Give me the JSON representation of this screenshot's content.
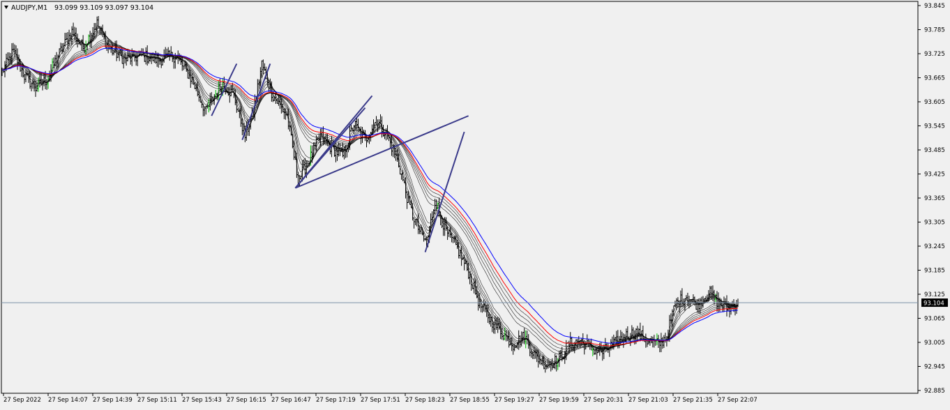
{
  "header": {
    "symbol_label": "AUDJPY,M1",
    "ohlc": "93.099 93.109 93.097 93.104"
  },
  "colors": {
    "background": "#f0f0f0",
    "bars": "#000000",
    "up_tick": "#00c000",
    "ema_fast": "#000000",
    "ema_mid": "#ff0000",
    "ema_slow": "#0000ff",
    "trendline": "#3a3a8a",
    "price_line": "#7a8fa8",
    "price_label_bg": "#000000",
    "price_label_text": "#ffffff"
  },
  "chart_data": {
    "type": "candlestick-bars",
    "symbol": "AUDJPY",
    "timeframe": "M1",
    "current_price": "93.104",
    "ylim": [
      92.885,
      93.845
    ],
    "y_ticks": [
      "93.845",
      "93.785",
      "93.725",
      "93.665",
      "93.605",
      "93.545",
      "93.485",
      "93.425",
      "93.365",
      "93.305",
      "93.245",
      "93.185",
      "93.125",
      "93.065",
      "93.005",
      "92.945",
      "92.885"
    ],
    "x_ticks": [
      "27 Sep 2022",
      "27 Sep 14:07",
      "27 Sep 14:39",
      "27 Sep 15:11",
      "27 Sep 15:43",
      "27 Sep 16:15",
      "27 Sep 16:47",
      "27 Sep 17:19",
      "27 Sep 17:51",
      "27 Sep 18:23",
      "27 Sep 18:55",
      "27 Sep 19:27",
      "27 Sep 19:59",
      "27 Sep 20:31",
      "27 Sep 21:03",
      "27 Sep 21:35",
      "27 Sep 22:07"
    ],
    "x_minutes": [
      0,
      527
    ],
    "price_path": [
      [
        0,
        93.68
      ],
      [
        8,
        93.73
      ],
      [
        16,
        93.67
      ],
      [
        24,
        93.64
      ],
      [
        32,
        93.66
      ],
      [
        40,
        93.72
      ],
      [
        50,
        93.78
      ],
      [
        58,
        93.74
      ],
      [
        68,
        93.8
      ],
      [
        76,
        93.74
      ],
      [
        88,
        93.71
      ],
      [
        100,
        93.72
      ],
      [
        112,
        93.71
      ],
      [
        124,
        93.72
      ],
      [
        136,
        93.66
      ],
      [
        146,
        93.58
      ],
      [
        152,
        93.62
      ],
      [
        158,
        93.65
      ],
      [
        166,
        93.62
      ],
      [
        174,
        93.52
      ],
      [
        180,
        93.58
      ],
      [
        186,
        93.7
      ],
      [
        194,
        93.62
      ],
      [
        204,
        93.57
      ],
      [
        212,
        93.41
      ],
      [
        220,
        93.46
      ],
      [
        228,
        93.52
      ],
      [
        236,
        93.49
      ],
      [
        244,
        93.47
      ],
      [
        252,
        93.55
      ],
      [
        260,
        93.51
      ],
      [
        268,
        93.56
      ],
      [
        276,
        93.52
      ],
      [
        284,
        93.45
      ],
      [
        292,
        93.34
      ],
      [
        298,
        93.29
      ],
      [
        304,
        93.25
      ],
      [
        310,
        93.36
      ],
      [
        318,
        93.28
      ],
      [
        326,
        93.24
      ],
      [
        334,
        93.18
      ],
      [
        342,
        93.1
      ],
      [
        350,
        93.06
      ],
      [
        358,
        93.03
      ],
      [
        366,
        93.0
      ],
      [
        374,
        93.02
      ],
      [
        382,
        92.97
      ],
      [
        390,
        92.95
      ],
      [
        398,
        92.96
      ],
      [
        406,
        93.0
      ],
      [
        414,
        93.01
      ],
      [
        422,
        92.99
      ],
      [
        430,
        92.98
      ],
      [
        438,
        93.0
      ],
      [
        446,
        93.02
      ],
      [
        454,
        93.03
      ],
      [
        462,
        93.01
      ],
      [
        470,
        93.0
      ],
      [
        476,
        93.02
      ],
      [
        482,
        93.1
      ],
      [
        490,
        93.12
      ],
      [
        498,
        93.1
      ],
      [
        506,
        93.13
      ],
      [
        514,
        93.1
      ],
      [
        520,
        93.09
      ],
      [
        527,
        93.104
      ]
    ],
    "ema_ribbon": {
      "periods": [
        3,
        5,
        8,
        10,
        12,
        15,
        30,
        35,
        40,
        45,
        50,
        60
      ],
      "highlighted": [
        {
          "period": 50,
          "color": "#ff0000"
        },
        {
          "period": 60,
          "color": "#0000ff"
        }
      ]
    },
    "trendlines": [
      [
        [
          150,
          93.57
        ],
        [
          168,
          93.7
        ]
      ],
      [
        [
          172,
          93.51
        ],
        [
          192,
          93.7
        ]
      ],
      [
        [
          210,
          93.39
        ],
        [
          260,
          93.59
        ]
      ],
      [
        [
          210,
          93.39
        ],
        [
          265,
          93.62
        ]
      ],
      [
        [
          210,
          93.39
        ],
        [
          334,
          93.57
        ]
      ],
      [
        [
          303,
          93.23
        ],
        [
          331,
          93.53
        ]
      ]
    ],
    "grid": false,
    "legend": "none"
  }
}
